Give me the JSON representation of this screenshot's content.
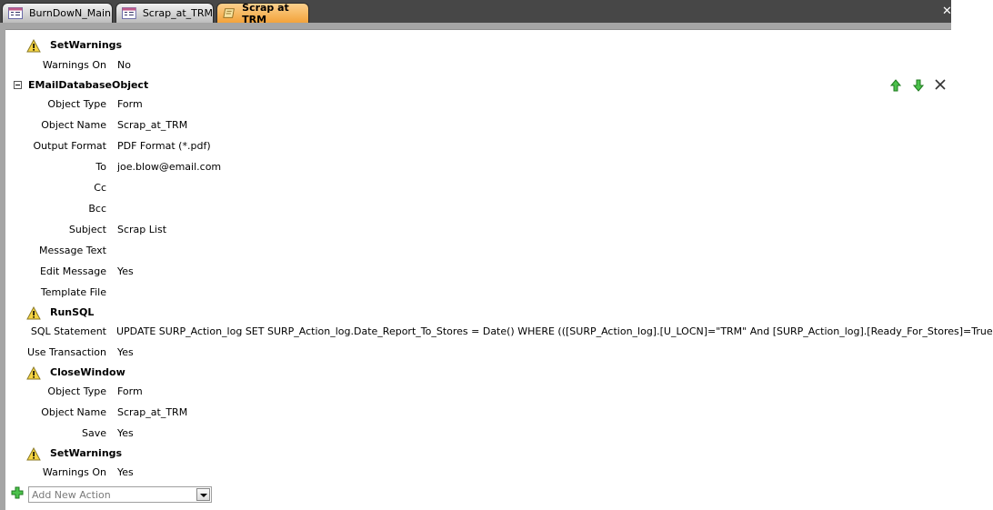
{
  "tabs": [
    {
      "label": "BurnDowN_Main",
      "icon": "form-icon",
      "active": false
    },
    {
      "label": "Scrap_at_TRM",
      "icon": "form-icon",
      "active": false
    },
    {
      "label": "Scrap at TRM",
      "icon": "macro-icon",
      "active": true
    }
  ],
  "actions": {
    "a1": {
      "name": "SetWarnings",
      "args": {
        "warnings_on": {
          "label": "Warnings On",
          "value": "No"
        }
      }
    },
    "a2": {
      "name": "EMailDatabaseObject",
      "args": {
        "object_type": {
          "label": "Object Type",
          "value": "Form"
        },
        "object_name": {
          "label": "Object Name",
          "value": "Scrap_at_TRM"
        },
        "output_format": {
          "label": "Output Format",
          "value": "PDF Format (*.pdf)"
        },
        "to": {
          "label": "To",
          "value": "joe.blow@email.com"
        },
        "cc": {
          "label": "Cc",
          "value": ""
        },
        "bcc": {
          "label": "Bcc",
          "value": ""
        },
        "subject": {
          "label": "Subject",
          "value": "Scrap List"
        },
        "message_text": {
          "label": "Message Text",
          "value": ""
        },
        "edit_message": {
          "label": "Edit Message",
          "value": "Yes"
        },
        "template_file": {
          "label": "Template File",
          "value": ""
        }
      }
    },
    "a3": {
      "name": "RunSQL",
      "args": {
        "sql_statement": {
          "label": "SQL Statement",
          "value": "UPDATE SURP_Action_log SET SURP_Action_log.Date_Report_To_Stores = Date() WHERE (([SURP_Action_log].[U_LOCN]=\"TRM\" And [SURP_Action_log].[Ready_For_Stores]=True A..."
        },
        "use_transaction": {
          "label": "Use Transaction",
          "value": "Yes"
        }
      }
    },
    "a4": {
      "name": "CloseWindow",
      "args": {
        "object_type": {
          "label": "Object Type",
          "value": "Form"
        },
        "object_name": {
          "label": "Object Name",
          "value": "Scrap_at_TRM"
        },
        "save": {
          "label": "Save",
          "value": "Yes"
        }
      }
    },
    "a5": {
      "name": "SetWarnings",
      "args": {
        "warnings_on": {
          "label": "Warnings On",
          "value": "Yes"
        }
      }
    }
  },
  "add_action": {
    "placeholder": "Add New Action"
  },
  "colors": {
    "active_tab": "#f3a33b",
    "tabbar": "#474747",
    "arrow_green": "#3cb33c",
    "warning_yellow": "#f5d442"
  }
}
